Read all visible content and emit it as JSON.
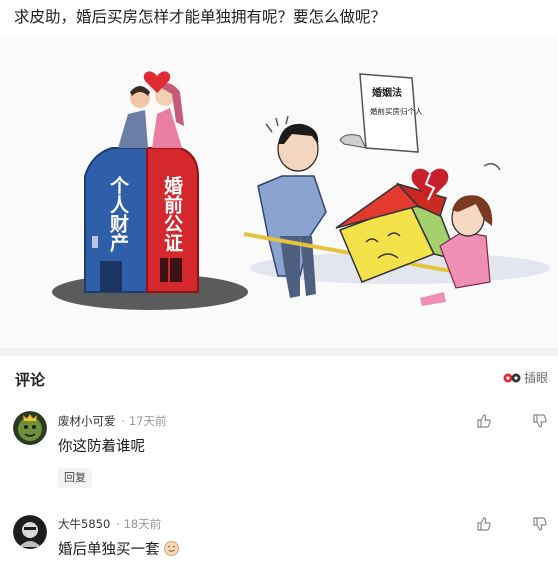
{
  "post": {
    "title": "求皮助，婚后买房怎样才能单独拥有呢？要怎么做呢？"
  },
  "illustration": {
    "left_building_text": "个人财产",
    "right_building_text": "婚前公证",
    "document_text": "婚姻法",
    "document_subtext": "婚前买房归个人"
  },
  "comments_section": {
    "title": "评论",
    "eye_toggle_label": "插眼"
  },
  "comments": [
    {
      "username": "废材小可爱",
      "time": "17天前",
      "text": "你这防着谁呢",
      "reply_label": "回复"
    },
    {
      "username": "大牛5850",
      "time": "18天前",
      "text": "婚后单独买一套"
    }
  ],
  "colors": {
    "blue_building": "#2e5fa8",
    "red_building": "#d4282d",
    "heart": "#e02a35",
    "house_roof": "#e33a2f",
    "house_wall": "#f4e24a"
  }
}
